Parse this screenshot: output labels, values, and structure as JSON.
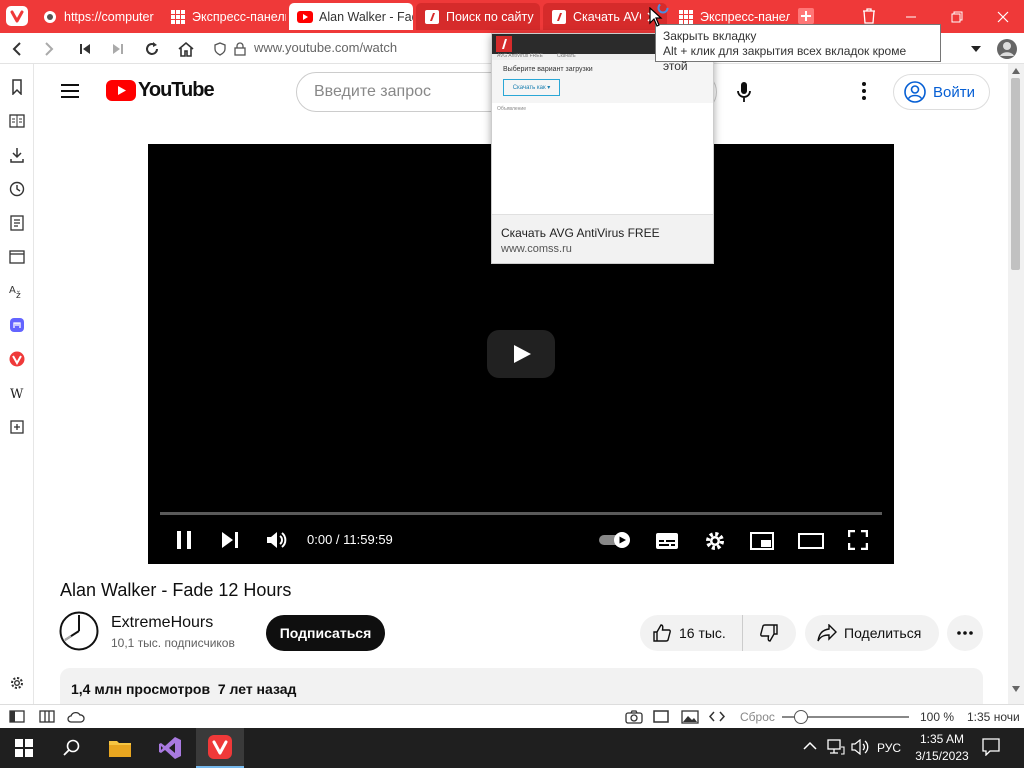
{
  "tabs": [
    {
      "label": "https://computer",
      "icon": "site-icon"
    },
    {
      "label": "Экспресс-панель",
      "icon": "grid-icon"
    },
    {
      "label": "Alan Walker - Fad",
      "icon": "youtube-icon"
    },
    {
      "label": "Поиск по сайту",
      "icon": "comss-icon"
    },
    {
      "label": "Скачать AVG",
      "icon": "comss-icon"
    },
    {
      "label": "Экспресс-панель",
      "icon": "grid-icon"
    }
  ],
  "address": {
    "url": "www.youtube.com/watch"
  },
  "tooltip": {
    "line1": "Закрыть вкладку",
    "line2": "Alt + клик для закрытия всех вкладок кроме этой"
  },
  "tab_preview": {
    "page_header": "AVG AntiVirus FREE          Скачать",
    "page_text": "Выберите вариант загрузки",
    "page_button": "Скачать как ▾",
    "page_label": "Объявление",
    "title": "Скачать AVG AntiVirus FREE",
    "domain": "www.comss.ru"
  },
  "youtube": {
    "logo_text": "YouTube",
    "search_placeholder": "Введите запрос",
    "signin_label": "Войти",
    "player": {
      "time": "0:00 / 11:59:59",
      "progress": 0.0
    },
    "video_title": "Alan Walker - Fade 12 Hours",
    "channel_name": "ExtremeHours",
    "subscribers": "10,1 тыс. подписчиков",
    "subscribe_label": "Подписаться",
    "likes": "16 тыс.",
    "share_label": "Поделиться",
    "description_meta": "1,4 млн просмотров  7 лет назад"
  },
  "statusbar": {
    "reset_label": "Сброс",
    "zoom": "100 %",
    "zoom_level": 0.15,
    "clock": "1:35 ночи"
  },
  "taskbar": {
    "lang": "РУС",
    "time": "1:35 AM",
    "date": "3/15/2023"
  },
  "colors": {
    "vivaldi_red": "#ef3939",
    "youtube_red": "#ff0000",
    "taskbar": "#1f1f1f"
  }
}
